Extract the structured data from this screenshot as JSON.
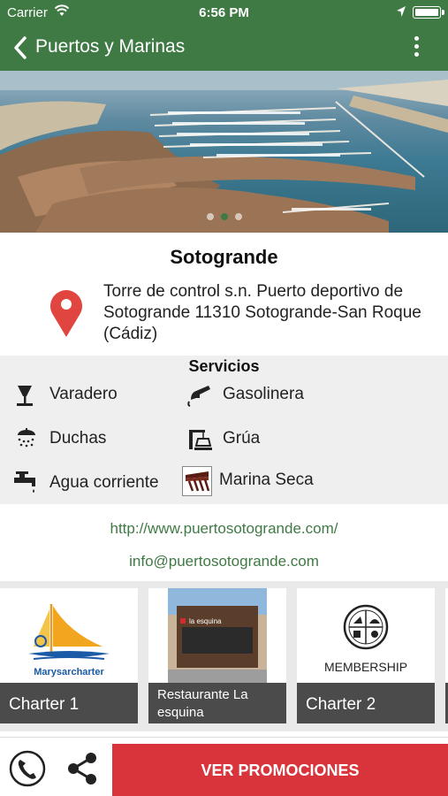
{
  "statusbar": {
    "carrier": "Carrier",
    "time": "6:56 PM",
    "battery_level": 1.0
  },
  "navbar": {
    "title": "Puertos y Marinas",
    "back_icon": "chevron-left-icon",
    "menu_icon": "more-vertical-icon"
  },
  "hero": {
    "slides": 3,
    "active_slide": 2
  },
  "marina": {
    "name": "Sotogrande",
    "address": "Torre de control s.n. Puerto deportivo de Sotogrande 11310 Sotogrande-San Roque (Cádiz)"
  },
  "services": {
    "heading": "Servicios",
    "items": [
      {
        "label": "Varadero",
        "icon": "boat-lift-icon"
      },
      {
        "label": "Gasolinera",
        "icon": "fuel-nozzle-icon"
      },
      {
        "label": "Duchas",
        "icon": "shower-icon"
      },
      {
        "label": "Grúa",
        "icon": "crane-icon"
      },
      {
        "label": "Agua corriente",
        "icon": "water-tap-icon"
      },
      {
        "label": "Marina Seca",
        "icon": "dry-marina-icon"
      }
    ]
  },
  "contact": {
    "website": "http://www.puertosotogrande.com/",
    "email": "info@puertosotogrande.com"
  },
  "cards": [
    {
      "caption": "Charter  1",
      "logo_text": "Marysarcharter"
    },
    {
      "caption": "Restaurante La esquina",
      "logo_text": "la esquina"
    },
    {
      "caption": "Charter 2",
      "logo_text": "MEMBERSHIP"
    }
  ],
  "bottombar": {
    "promo_label": "VER PROMOCIONES",
    "phone_icon": "phone-icon",
    "share_icon": "share-icon"
  },
  "colors": {
    "primary": "#3f7a45",
    "promo": "#d9333b",
    "pin": "#e0463f"
  }
}
